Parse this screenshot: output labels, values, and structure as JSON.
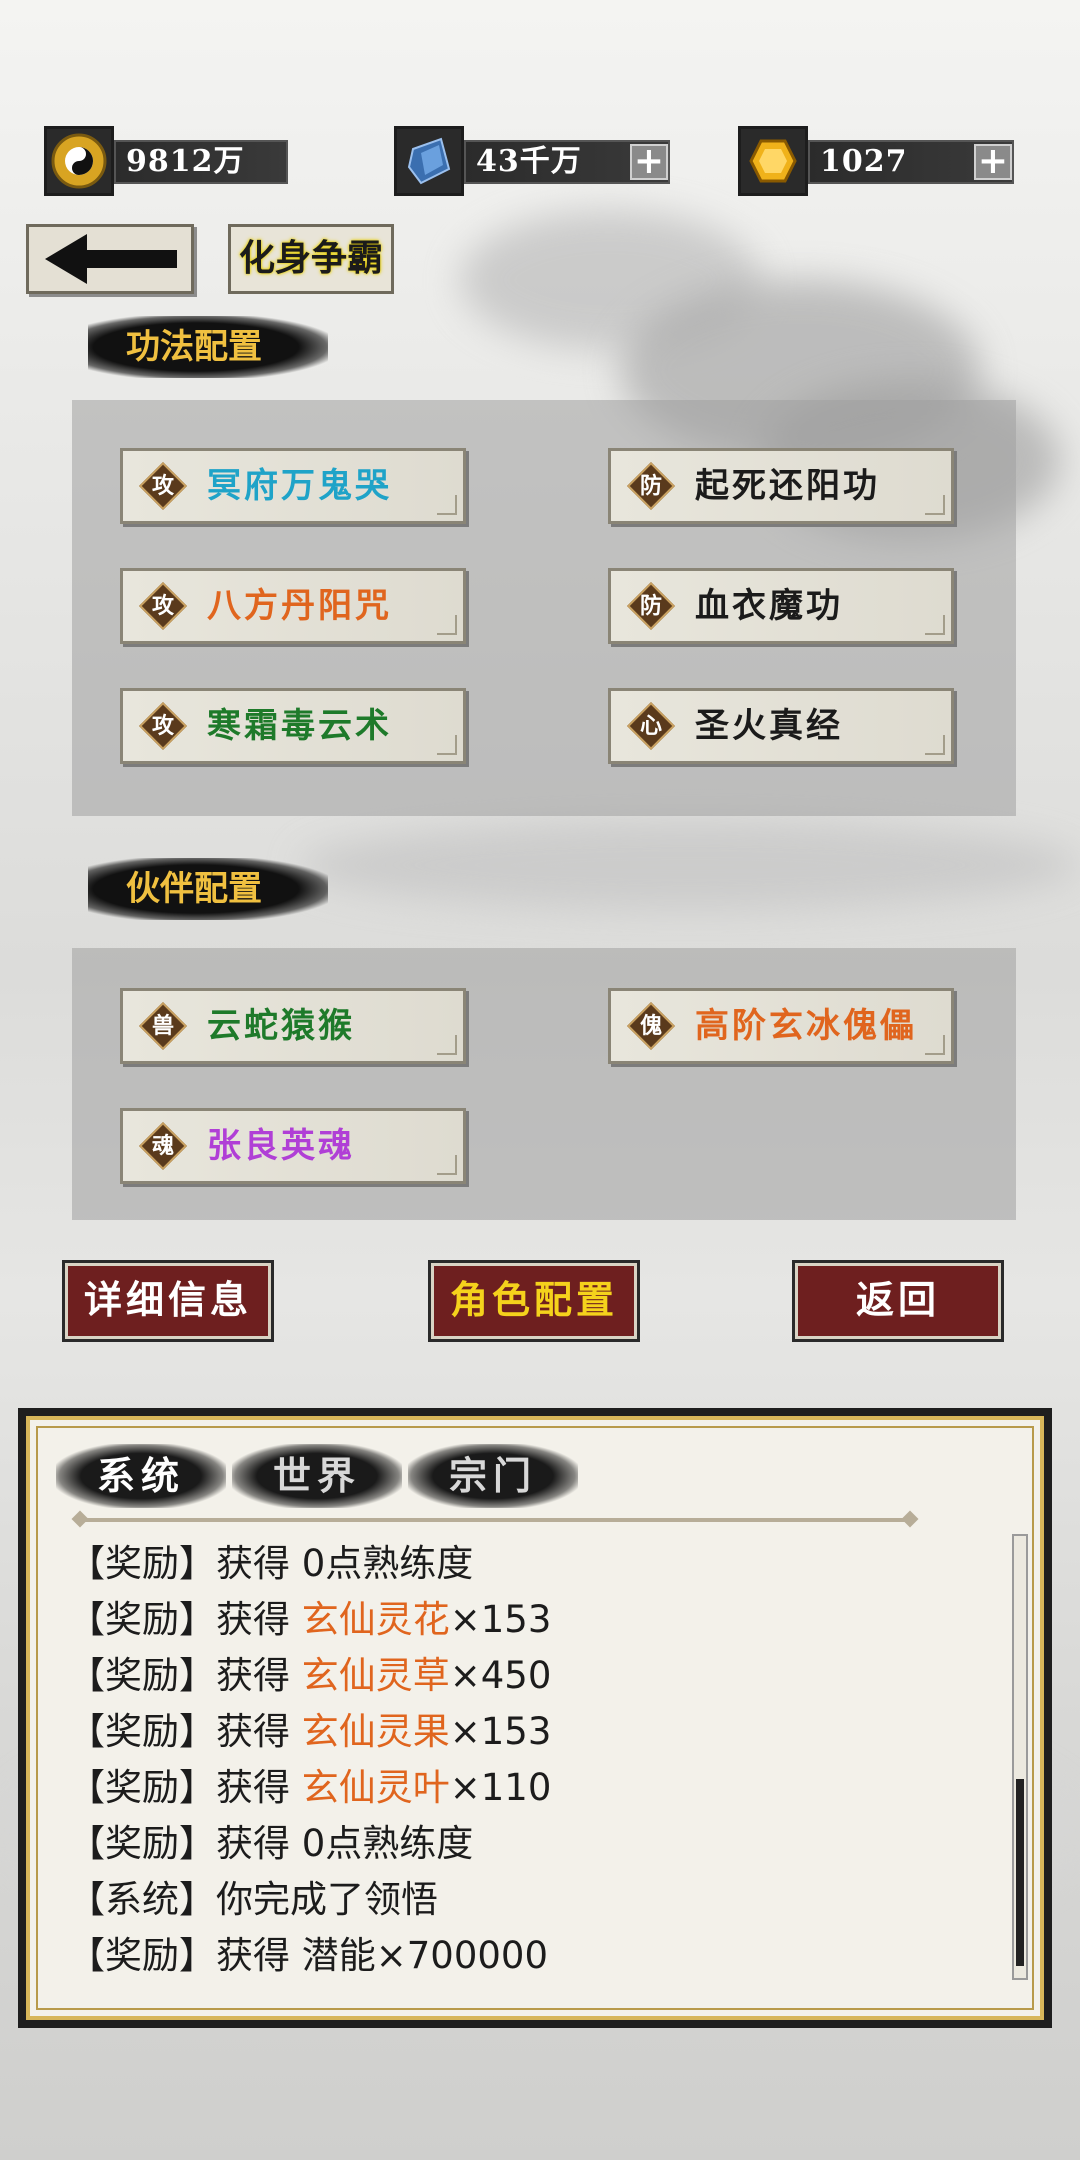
{
  "resources": {
    "coins": {
      "icon": "yin-yang-coin-icon",
      "value": "9812万"
    },
    "crystal": {
      "icon": "blue-crystal-icon",
      "value": "43千万",
      "plus": "+"
    },
    "gold": {
      "icon": "gold-gem-icon",
      "value": "1027",
      "plus": "+"
    }
  },
  "nav": {
    "back_icon": "arrow-left-icon",
    "title": "化身争霸"
  },
  "gongfa": {
    "header": "功法配置",
    "items": [
      {
        "tag": "攻",
        "name": "冥府万鬼哭",
        "color": "#1fa3c8"
      },
      {
        "tag": "防",
        "name": "起死还阳功",
        "color": "#1b1b1b"
      },
      {
        "tag": "攻",
        "name": "八方丹阳咒",
        "color": "#e0651e"
      },
      {
        "tag": "防",
        "name": "血衣魔功",
        "color": "#1b1b1b"
      },
      {
        "tag": "攻",
        "name": "寒霜毒云术",
        "color": "#1e7a2a"
      },
      {
        "tag": "心",
        "name": "圣火真经",
        "color": "#1b1b1b"
      }
    ]
  },
  "huoban": {
    "header": "伙伴配置",
    "items": [
      {
        "tag": "兽",
        "name": "云蛇猿猴",
        "color": "#1e7a2a"
      },
      {
        "tag": "傀",
        "name": "高阶玄冰傀儡",
        "color": "#e0651e"
      },
      {
        "tag": "魂",
        "name": "张良英魂",
        "color": "#b03fd6"
      }
    ]
  },
  "buttons": {
    "detail": "详细信息",
    "role": "角色配置",
    "back": "返回"
  },
  "log": {
    "tabs": [
      "系统",
      "世界",
      "宗门"
    ],
    "lines": [
      {
        "prefix": "【奖励】获得 ",
        "item": "",
        "suffix": "0点熟练度"
      },
      {
        "prefix": "【奖励】获得 ",
        "item": "玄仙灵花",
        "suffix": "×153"
      },
      {
        "prefix": "【奖励】获得 ",
        "item": "玄仙灵草",
        "suffix": "×450"
      },
      {
        "prefix": "【奖励】获得 ",
        "item": "玄仙灵果",
        "suffix": "×153"
      },
      {
        "prefix": "【奖励】获得 ",
        "item": "玄仙灵叶",
        "suffix": "×110"
      },
      {
        "prefix": "【奖励】获得 ",
        "item": "",
        "suffix": "0点熟练度"
      },
      {
        "prefix": "【系统】你完成了领悟",
        "item": "",
        "suffix": ""
      },
      {
        "prefix": "【奖励】获得 ",
        "item": "",
        "suffix": "潜能×700000"
      }
    ],
    "scroll_position": 0.55
  }
}
